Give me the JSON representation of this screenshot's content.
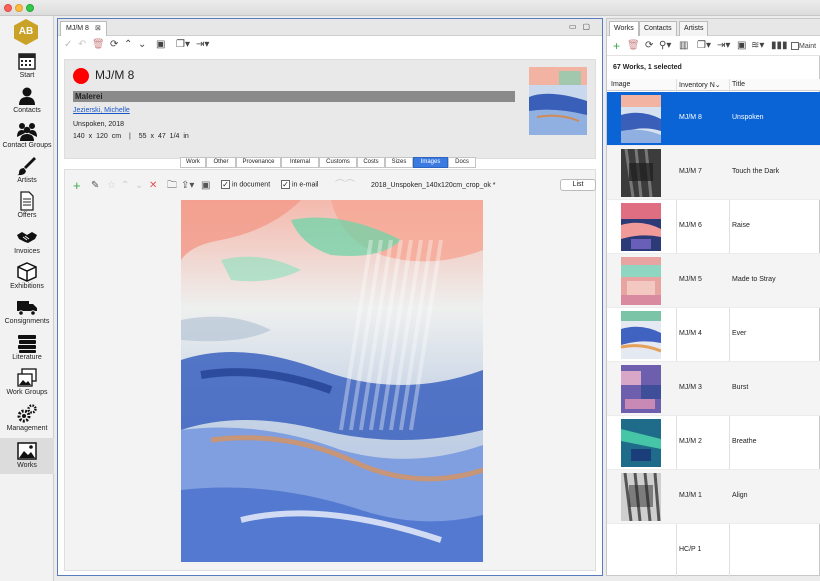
{
  "app": {
    "logo_text": "AB"
  },
  "nav": [
    {
      "label": "Start",
      "icon": "calendar-icon"
    },
    {
      "label": "Contacts",
      "icon": "person-icon"
    },
    {
      "label": "Contact Groups",
      "icon": "people-group-icon"
    },
    {
      "label": "Artists",
      "icon": "paintbrush-icon"
    },
    {
      "label": "Offers",
      "icon": "document-icon"
    },
    {
      "label": "Invoices",
      "icon": "handshake-icon"
    },
    {
      "label": "Exhibitions",
      "icon": "cube-icon"
    },
    {
      "label": "Consignments",
      "icon": "truck-icon"
    },
    {
      "label": "Literature",
      "icon": "books-icon"
    },
    {
      "label": "Work Groups",
      "icon": "image-stack-icon"
    },
    {
      "label": "Management",
      "icon": "gears-icon"
    },
    {
      "label": "Works",
      "icon": "picture-icon",
      "active": true
    }
  ],
  "main": {
    "tab_label": "MJ/M 8",
    "record": {
      "inventory_no": "MJ/M 8",
      "status_color": "#ff0000",
      "category": "Malerei",
      "artist": "Jezierski, Michelle",
      "title_year": "Unspoken, 2018",
      "size_cm": "140 x 120 cm",
      "separator": "|",
      "size_in": "55 x 47 1/4 in"
    },
    "subtabs": [
      "Work",
      "Other",
      "Provenance",
      "Internal",
      "Customs",
      "Costs",
      "Sizes",
      "Images",
      "Docs"
    ],
    "active_subtab": "Images",
    "images": {
      "in_document_label": "in document",
      "in_email_label": "in e-mail",
      "in_document_checked": true,
      "in_email_checked": true,
      "filename": "2018_Unspoken_140x120cm_crop_ok *",
      "list_button": "List"
    }
  },
  "right": {
    "tabs": [
      "Works",
      "Contacts",
      "Artists"
    ],
    "active_tab": "Works",
    "maint_label": "Maint",
    "count_text": "67 Works, 1 selected",
    "columns": {
      "image": "Image",
      "inventory": "Inventory N",
      "title": "Title"
    },
    "rows": [
      {
        "inventory": "MJ/M 8",
        "title": "Unspoken",
        "selected": true
      },
      {
        "inventory": "MJ/M 7",
        "title": "Touch the Dark"
      },
      {
        "inventory": "MJ/M 6",
        "title": "Raise"
      },
      {
        "inventory": "MJ/M 5",
        "title": "Made to Stray"
      },
      {
        "inventory": "MJ/M 4",
        "title": "Ever"
      },
      {
        "inventory": "MJ/M 3",
        "title": "Burst"
      },
      {
        "inventory": "MJ/M 2",
        "title": "Breathe"
      },
      {
        "inventory": "MJ/M 1",
        "title": "Align"
      },
      {
        "inventory": "HC/P 1",
        "title": ""
      }
    ]
  },
  "colors": {
    "accent": "#3b7ae0",
    "selection": "#0a64d6",
    "logo": "#c9a227"
  }
}
